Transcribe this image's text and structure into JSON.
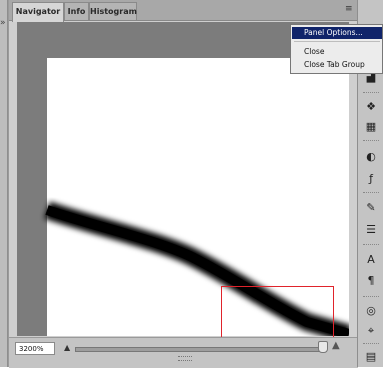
{
  "tabs": [
    {
      "label": "Navigator",
      "active": true
    },
    {
      "label": "Info",
      "active": false
    },
    {
      "label": "Histogram",
      "active": false
    }
  ],
  "zoom": {
    "value": "3200%",
    "slider_fraction": 0.98
  },
  "menu": {
    "items": [
      "Panel Options...",
      "Close",
      "Close Tab Group"
    ],
    "highlighted": "Panel Options..."
  },
  "icons": {
    "left_grip": "collapse-arrows-icon",
    "panel_menu": "panel-menu-icon",
    "zoom_out": "zoom-out-mountain-icon",
    "zoom_in": "zoom-in-mountain-icon",
    "right_tools": [
      "histogram-icon",
      "3d-icon",
      "layers-comp-icon",
      "adjustments-icon",
      "styles-icon",
      "clone-source-icon",
      "brush-preset-icon",
      "character-icon",
      "paragraph-icon",
      "3d-material-icon",
      "3d-axis-icon",
      "layer-icon"
    ]
  },
  "colors": {
    "view_box": "#e0232b",
    "menu_highlight": "#10246a"
  }
}
